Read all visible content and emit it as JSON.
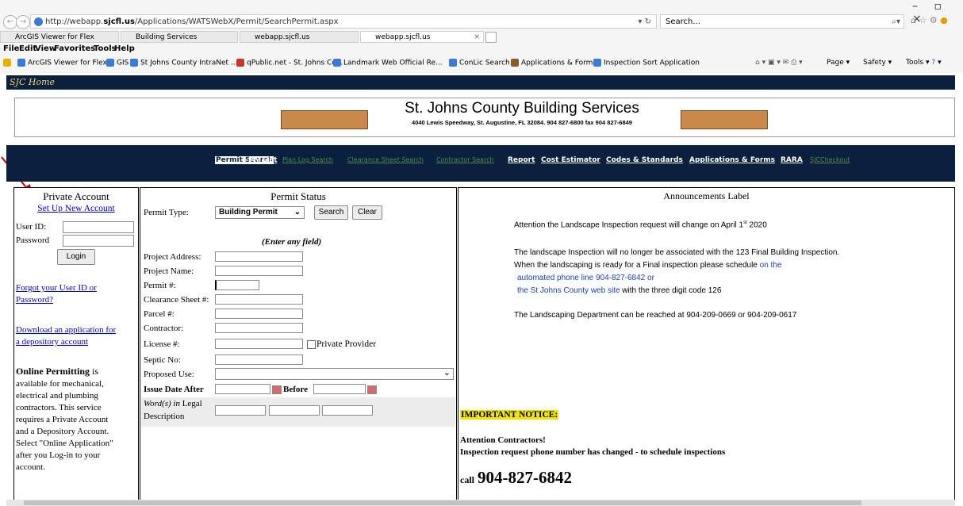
{
  "browser": {
    "url_prefix": "http://webapp.",
    "url_domain": "sjcfl.us",
    "url_path": "/Applications/WATSWebX/Permit/SearchPermit.aspx",
    "search_placeholder": "Search...",
    "tabs": [
      "ArcGIS Viewer for Flex",
      "Building Services",
      "webapp.sjcfl.us",
      "webapp.sjcfl.us"
    ],
    "menu": [
      "File",
      "Edit",
      "View",
      "Favorites",
      "Tools",
      "Help"
    ],
    "favorites": [
      "ArcGIS Viewer for Flex",
      "GIS",
      "St Johns County IntraNet ...",
      "qPublic.net - St. Johns Co...",
      "Landmark Web Official Re...",
      "ConLic Search",
      "Applications & Forms",
      "Inspection Sort Application"
    ],
    "command_bar": [
      "Page",
      "Safety",
      "Tools"
    ]
  },
  "page": {
    "home_label": "SJC Home",
    "title": "St. Johns County Building Services",
    "address_line": "4040 Lewis Speedway, St. Augustine, FL 32084.  904 827-6800 fax 904 827-6849"
  },
  "nav": {
    "links": [
      "Permit Search",
      "My List",
      "Plan Log Search",
      "Clearance Sheet Search",
      "Contractor Search",
      "Report",
      "Cost Estimator",
      "Codes & Standards",
      "Applications & Forms",
      "RARA",
      "SJCCheckout"
    ]
  },
  "account": {
    "title": "Private Account",
    "setup_link": "Set Up New Account",
    "userid_label": "User ID:",
    "password_label": "Password",
    "login_button": "Login",
    "forgot_link_1": "Forgot your User ID or",
    "forgot_link_2": "Password?",
    "download_link_1": "Download an application for",
    "download_link_2": "a depository account",
    "online_bold": "Online Permitting",
    "online_text_1": " is",
    "online_lines": [
      "available for mechanical,",
      "electrical and plumbing",
      "contractors. This service",
      "requires a Private Account",
      "and a Depository Account.",
      "Select \"Online Application\"",
      "after you Log-in to your",
      "account."
    ]
  },
  "permit": {
    "title": "Permit Status",
    "type_label": "Permit Type:",
    "type_value": "Building Permit",
    "search_button": "Search",
    "clear_button": "Clear",
    "hint": "(Enter any field)",
    "fields": [
      "Project Address:",
      "Project Name:",
      "Permit #:",
      "Clearance Sheet #:",
      "Parcel #:",
      "Contractor:",
      "License #:",
      "Septic No:",
      "Proposed Use:"
    ],
    "private_provider": "Private Provider",
    "issue_after": "Issue Date After",
    "before": "Before",
    "words_italic": "Word(s) in",
    "words_rest": " Legal",
    "description": "Description"
  },
  "announcements": {
    "title": "Announcements Label",
    "line1_a": "Attention the Landscape Inspection request will change on April 1",
    "line1_sup": "st",
    "line1_b": " 2020",
    "p2_line1": "The landscape Inspection will no longer be associated with the 123 Final Building Inspection.",
    "p2_line2_a": "When the landscaping is ready for a Final inspection please schedule ",
    "p2_line2_b": "on the",
    "p2_line3": "automated phone line 904-827-6842 or",
    "p2_line4_a": "the St Johns County web site",
    "p2_line4_b": " with the three digit code 126",
    "p3": "The Landscaping Department can be reached at 904-209-0669 or 904-209-0617",
    "notice": "IMPORTANT NOTICE:",
    "contractors": "Attention Contractors!",
    "phone_changed": "Inspection request phone number has changed - to schedule inspections",
    "call": "call",
    "phone": "904-827-6842"
  },
  "colors": {
    "navy": "#0b1f3f",
    "link": "#0000cc",
    "notice_bg": "#f2e600",
    "home_text": "#f0d070"
  }
}
